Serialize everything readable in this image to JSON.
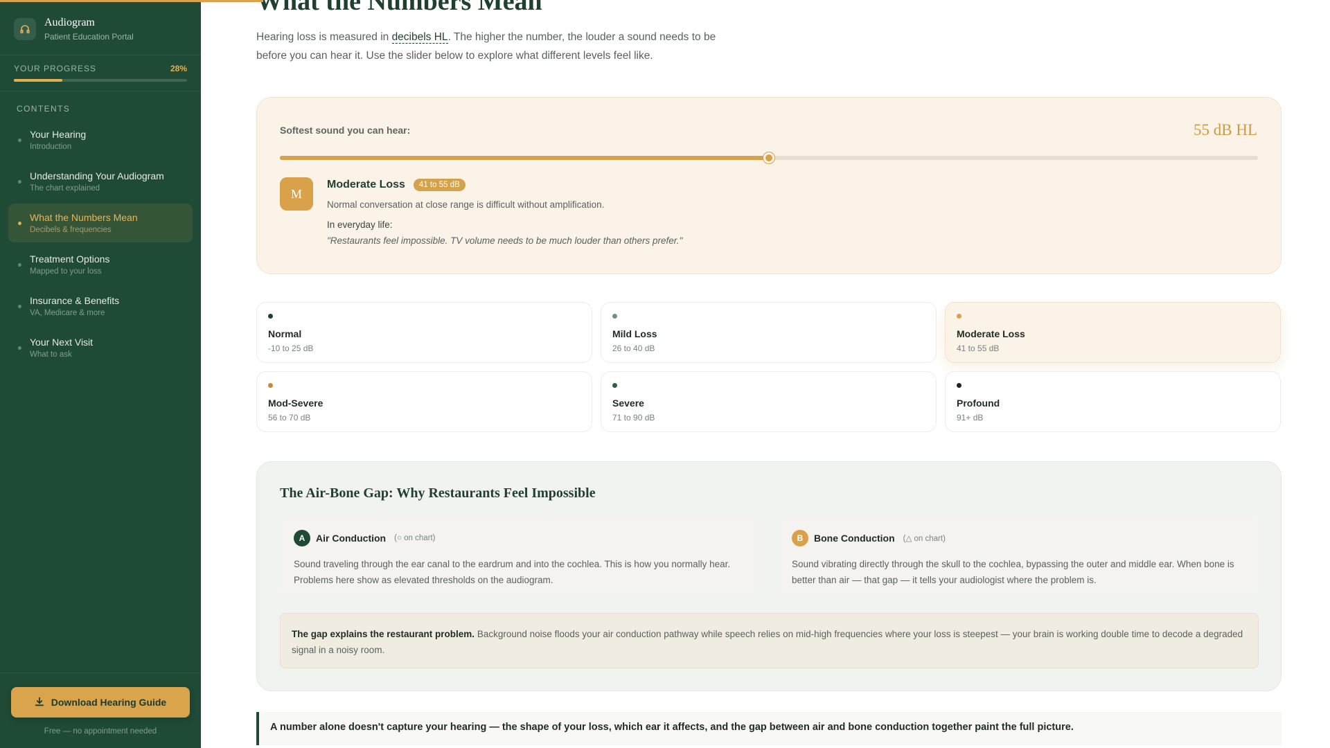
{
  "app": {
    "title": "Audiogram",
    "subtitle": "Patient Education Portal"
  },
  "progress": {
    "label": "YOUR PROGRESS",
    "percent_text": "28%",
    "value": 0.28
  },
  "sidebar": {
    "contents_label": "CONTENTS",
    "items": [
      {
        "title": "Your Hearing",
        "subtitle": "Introduction",
        "active": false
      },
      {
        "title": "Understanding Your Audiogram",
        "subtitle": "The chart explained",
        "active": false
      },
      {
        "title": "What the Numbers Mean",
        "subtitle": "Decibels & frequencies",
        "active": true
      },
      {
        "title": "Treatment Options",
        "subtitle": "Mapped to your loss",
        "active": false
      },
      {
        "title": "Insurance & Benefits",
        "subtitle": "VA, Medicare & more",
        "active": false
      },
      {
        "title": "Your Next Visit",
        "subtitle": "What to ask",
        "active": false
      }
    ],
    "download_label": "Download Hearing Guide",
    "download_note": "Free — no appointment needed"
  },
  "main": {
    "title": "What the Numbers Mean",
    "intro_before": "Hearing loss is measured in ",
    "intro_link": "decibels HL",
    "intro_after": ". The higher the number, the louder a sound needs to be before you can hear it. Use the slider below to explore what different levels feel like."
  },
  "explorer": {
    "label": "Softest sound you can hear:",
    "value_text": "55 dB HL",
    "slider_value": 55,
    "slider_min": -10,
    "slider_max": 120,
    "badge_letter": "M",
    "level_name": "Moderate Loss",
    "level_range": "41 to 55 dB",
    "description": "Normal conversation at close range is difficult without amplification.",
    "everyday_label": "In everyday life:",
    "quote": "\"Restaurants feel impossible. TV volume needs to be much louder than others prefer.\""
  },
  "levels": [
    {
      "name": "Normal",
      "range": "-10 to 25 dB",
      "color": "#1f3f30",
      "selected": false
    },
    {
      "name": "Mild Loss",
      "range": "26 to 40 dB",
      "color": "#6f8f80",
      "selected": false
    },
    {
      "name": "Moderate Loss",
      "range": "41 to 55 dB",
      "color": "#d9a24a",
      "selected": true
    },
    {
      "name": "Mod-Severe",
      "range": "56 to 70 dB",
      "color": "#c48a3a",
      "selected": false
    },
    {
      "name": "Severe",
      "range": "71 to 90 dB",
      "color": "#2f5e49",
      "selected": false
    },
    {
      "name": "Profound",
      "range": "91+ dB",
      "color": "#1b2620",
      "selected": false
    }
  ],
  "gap": {
    "title": "The Air-Bone Gap: Why Restaurants Feel Impossible",
    "air": {
      "letter": "A",
      "name": "Air Conduction",
      "note": "(○ on chart)",
      "text": "Sound traveling through the ear canal to the eardrum and into the cochlea. This is how you normally hear. Problems here show as elevated thresholds on the audiogram.",
      "color": "#1f4a36"
    },
    "bone": {
      "letter": "B",
      "name": "Bone Conduction",
      "note": "(△ on chart)",
      "text": "Sound vibrating directly through the skull to the cochlea, bypassing the outer and middle ear. When bone is better than air — that gap — it tells your audiologist where the problem is.",
      "color": "#d9a24a"
    },
    "callout_bold": "The gap explains the restaurant problem.",
    "callout_text": " Background noise floods your air conduction pathway while speech relies on mid-high frequencies where your loss is steepest — your brain is working double time to decode a degraded signal in a noisy room."
  },
  "takeaway": "A number alone doesn't capture your hearing — the shape of your loss, which ear it affects, and the gap between air and bone conduction together paint the full picture."
}
